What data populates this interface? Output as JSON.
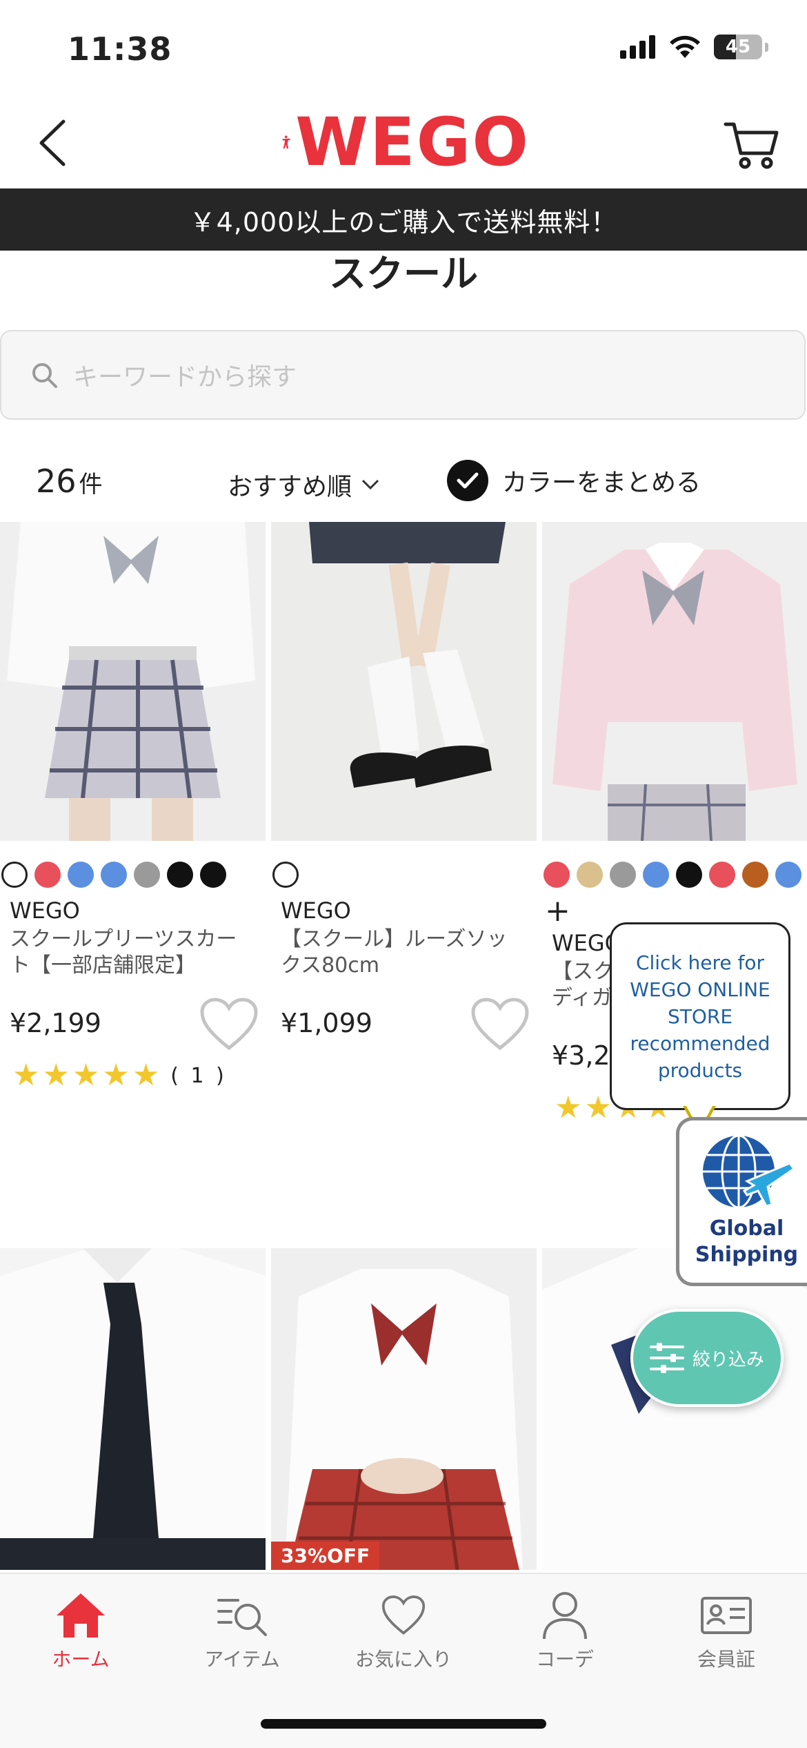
{
  "status_bar": {
    "time": "11:38",
    "battery": "45"
  },
  "header": {
    "logo": "WEGO",
    "back_icon": "chevron-left-icon",
    "cart_icon": "cart-icon"
  },
  "promo": {
    "text": "￥4,000以上のご購入で送料無料！"
  },
  "page": {
    "title": "スクール"
  },
  "search": {
    "placeholder": "キーワードから探す"
  },
  "toolbar": {
    "count": "26",
    "count_unit": "件",
    "sort_label": "おすすめ順",
    "group_colors_label": "カラーをまとめる",
    "group_colors_checked": true
  },
  "products": [
    {
      "swatches": [
        "#ffffff",
        "#e8505b",
        "#5b8fe0",
        "#5b8fe0",
        "#9a9a9a",
        "#111111",
        "#111111"
      ],
      "brand": "WEGO",
      "name": "スクールプリーツスカート【一部店舗限定】",
      "price": "¥2,199",
      "stars": 5,
      "rating_count": "( 1 )"
    },
    {
      "swatches": [
        "#ffffff"
      ],
      "brand": "WEGO",
      "name": "【スクール】ルーズソックス80cm",
      "price": "¥1,099"
    },
    {
      "swatches": [
        "#e8505b",
        "#d9c08c",
        "#9a9a9a",
        "#5b8fe0",
        "#111111",
        "#e8505b",
        "#b85e1e",
        "#5b8fe0"
      ],
      "more": "+",
      "brand": "WEGO",
      "name": "【スク",
      "name_suffix": "ディガ",
      "price": "¥3,299",
      "stars": 4
    }
  ],
  "second_row": [
    {
      "badge": ""
    },
    {
      "badge": "33%OFF"
    },
    {
      "badge": ""
    }
  ],
  "tooltip": {
    "text": "Click here for WEGO ONLINE STORE recommended products"
  },
  "global_shipping": {
    "line1": "Global",
    "line2": "Shipping"
  },
  "filter": {
    "label": "絞り込み"
  },
  "tabs": [
    {
      "label": "ホーム",
      "icon": "home-icon",
      "active": true
    },
    {
      "label": "アイテム",
      "icon": "item-search-icon"
    },
    {
      "label": "お気に入り",
      "icon": "heart-icon"
    },
    {
      "label": "コーデ",
      "icon": "person-icon"
    },
    {
      "label": "会員証",
      "icon": "member-card-icon"
    }
  ],
  "colors": {
    "brand_red": "#e8323c",
    "promo_bg": "#262626",
    "filter_teal": "#5fc6b2",
    "star": "#f2c72b",
    "tooltip_text": "#1f5fa0"
  }
}
